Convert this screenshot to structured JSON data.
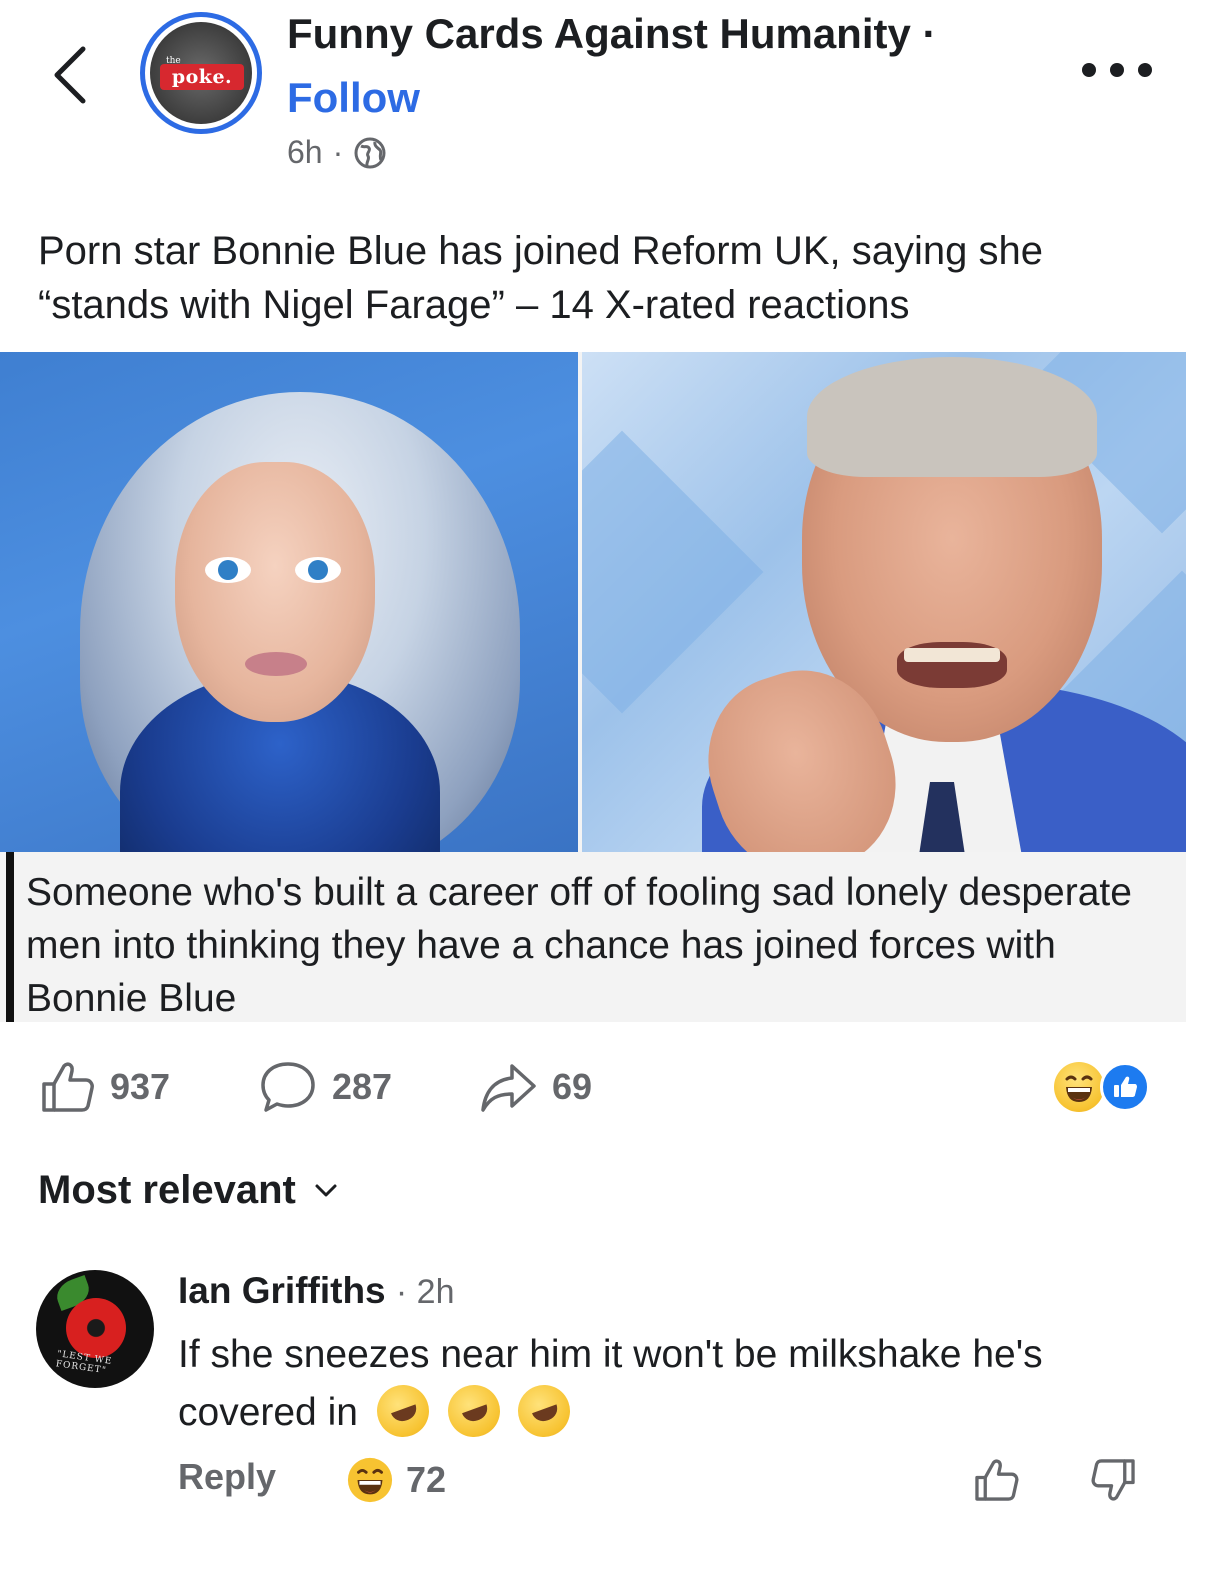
{
  "header": {
    "page_name": "Funny Cards Against Humanity ·",
    "follow_label": "Follow",
    "time": "6h",
    "separator": "·",
    "logo_text": "poke.",
    "logo_small": "the"
  },
  "post": {
    "text": "Porn star Bonnie Blue has joined Reform UK, saying she “stands with Nigel Farage” – 14 X-rated reactions",
    "image_caption": "Someone who's built a career off of fooling sad lonely desperate men into thinking they have a chance has joined forces with Bonnie Blue"
  },
  "actions": {
    "likes": "937",
    "comments": "287",
    "shares": "69"
  },
  "sort": {
    "label": "Most relevant"
  },
  "comment": {
    "author": "Ian Griffiths",
    "time": "· 2h",
    "text": "If she sneezes near him it won't be milkshake he's covered in",
    "reply_label": "Reply",
    "reaction_count": "72",
    "avatar_text": "\"LEST WE FORGET\""
  },
  "colors": {
    "accent": "#2d6be4",
    "text": "#1c1e21",
    "secondary": "#65676b"
  },
  "icons": [
    "back-icon",
    "more-icon",
    "globe-icon",
    "like-icon",
    "comment-icon",
    "share-icon",
    "laugh-emoji",
    "like-emoji",
    "chevron-down-icon",
    "rofl-emoji",
    "thumbs-up-icon",
    "thumbs-down-icon"
  ]
}
